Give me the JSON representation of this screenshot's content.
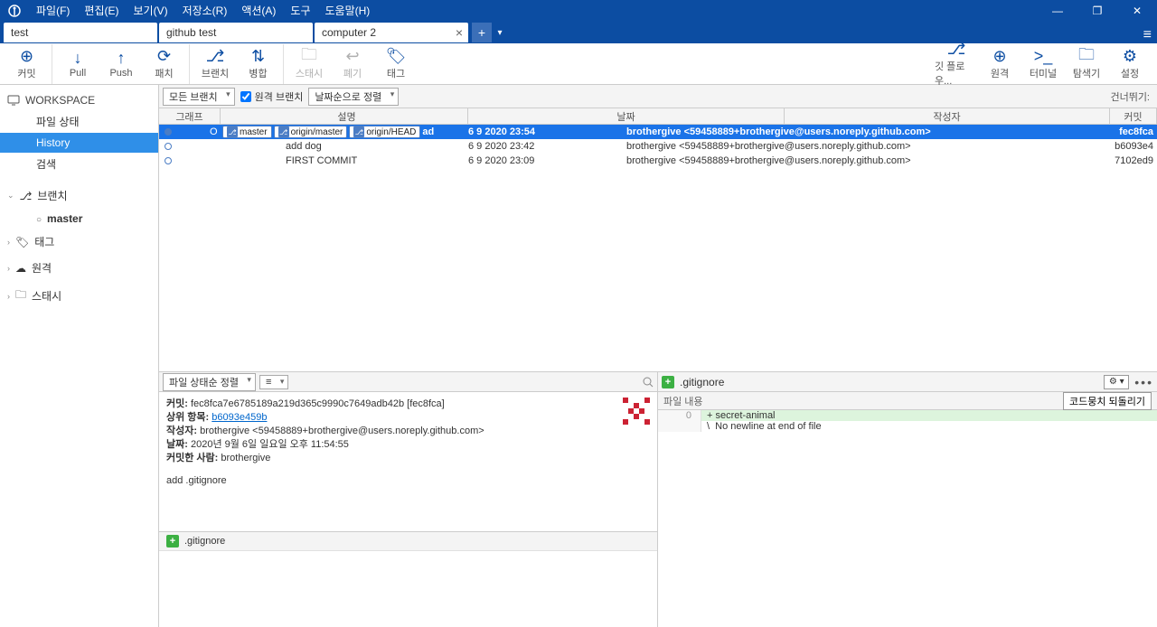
{
  "menu": [
    "파일(F)",
    "편집(E)",
    "보기(V)",
    "저장소(R)",
    "액션(A)",
    "도구",
    "도움말(H)"
  ],
  "window": {
    "min": "—",
    "max": "❐",
    "close": "✕"
  },
  "tabs": [
    {
      "label": "test"
    },
    {
      "label": "github test"
    },
    {
      "label": "computer 2",
      "closable": true
    }
  ],
  "toolbar": {
    "left": [
      {
        "label": "커밋",
        "icon": "⊕",
        "sep": true
      },
      {
        "label": "Pull",
        "icon": "↓"
      },
      {
        "label": "Push",
        "icon": "↑"
      },
      {
        "label": "패치",
        "icon": "⟳",
        "sep": true
      },
      {
        "label": "브랜치",
        "icon": "⎇"
      },
      {
        "label": "병합",
        "icon": "⇅",
        "sep": true
      },
      {
        "label": "스태시",
        "icon": "🗀",
        "disabled": true
      },
      {
        "label": "폐기",
        "icon": "↩",
        "disabled": true
      },
      {
        "label": "태그",
        "icon": "🏷"
      }
    ],
    "right": [
      {
        "label": "깃 플로우...",
        "icon": "⎇"
      },
      {
        "label": "원격",
        "icon": "⊕"
      },
      {
        "label": "터미널",
        "icon": ">_"
      },
      {
        "label": "탐색기",
        "icon": "🗀"
      },
      {
        "label": "설정",
        "icon": "⚙"
      }
    ]
  },
  "sidebar": {
    "workspace": {
      "head": "WORKSPACE",
      "items": [
        "파일 상태",
        "History",
        "검색"
      ],
      "selected": 1
    },
    "groups": [
      {
        "icon": "⎇",
        "label": "브랜치",
        "open": true,
        "children": [
          "master"
        ]
      },
      {
        "icon": "🏷",
        "label": "태그"
      },
      {
        "icon": "☁",
        "label": "원격"
      },
      {
        "icon": "🗀",
        "label": "스태시"
      }
    ]
  },
  "filter": {
    "branches": "모든 브랜치",
    "remote": "원격 브랜치",
    "sort": "날짜순으로 정렬",
    "skip": "건너뛰기:"
  },
  "columns": {
    "graph": "그래프",
    "desc": "설명",
    "date": "날짜",
    "author": "작성자",
    "commit": "커밋"
  },
  "rows": [
    {
      "selected": true,
      "tags": [
        "master",
        "origin/master",
        "origin/HEAD"
      ],
      "msg_prefix": "ad",
      "date": "6 9 2020 23:54",
      "author": "brothergive <59458889+brothergive@users.noreply.github.com>",
      "hash": "fec8fca"
    },
    {
      "msg": "add dog",
      "date": "6 9 2020 23:42",
      "author": "brothergive <59458889+brothergive@users.noreply.github.com>",
      "hash": "b6093e4"
    },
    {
      "msg": "FIRST COMMIT",
      "date": "6 9 2020 23:09",
      "author": "brothergive <59458889+brothergive@users.noreply.github.com>",
      "hash": "7102ed9"
    }
  ],
  "detail": {
    "sort": "파일 상태순 정렬",
    "commit_label": "커밋:",
    "commit": "fec8fca7e6785189a219d365c9990c7649adb42b [fec8fca]",
    "parent_label": "상위 항목:",
    "parent": "b6093e459b",
    "author_label": "작성자:",
    "author": "brothergive <59458889+brothergive@users.noreply.github.com>",
    "date_label": "날짜:",
    "date": "2020년 9월 6일 일요일 오후 11:54:55",
    "committer_label": "커밋한 사람:",
    "committer": "brothergive",
    "message": "add .gitignore",
    "file": ".gitignore"
  },
  "diff": {
    "file": ".gitignore",
    "head": "파일 내용",
    "revert": "코드뭉치 되돌리기",
    "lines": [
      {
        "n": "0",
        "t": "+ secret-animal",
        "add": true
      },
      {
        "n": "",
        "t": "\\  No newline at end of file"
      }
    ]
  }
}
